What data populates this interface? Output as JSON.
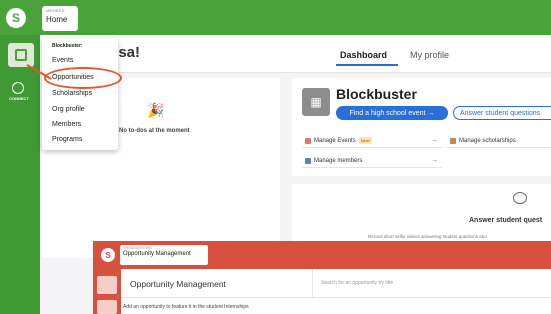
{
  "header": {
    "crumb_small": "MEMBER",
    "crumb_main": "Home",
    "logo_glyph": "S"
  },
  "sidebar": {
    "connect_label": "CONNECT"
  },
  "greeting": "ssa!",
  "tabs": [
    "Dashboard",
    "My profile"
  ],
  "dropdown": {
    "header": "Blockbuster:",
    "items": [
      "Events",
      "Opportunities",
      "Scholarships",
      "Org profile",
      "Members",
      "Programs"
    ]
  },
  "todo": {
    "icon": "🎉",
    "text": "No to-dos at the moment"
  },
  "org": {
    "name": "Blockbuster",
    "find_button": "Find a high school event →",
    "answer_button": "Answer student questions",
    "manage_events": "Manage Events",
    "new_badge": "New!",
    "manage_scholarships": "Manage scholarships",
    "manage_members": "Manage members"
  },
  "answer_card": {
    "title": "Answer student quest",
    "subtitle": "Record short selfie videos answering student questions abo"
  },
  "overlay": {
    "crumb_small": "ORGANIZATIONS",
    "crumb_main": "Opportunity Management",
    "title": "Opportunity Management",
    "search_placeholder": "Search for an opportunity by title",
    "info_text": "Add an opportunity to feature it in the student Internships"
  },
  "colors": {
    "green": "#4aa33a",
    "red": "#d8513f",
    "blue": "#2a6fd6",
    "highlight": "#e8532e"
  }
}
